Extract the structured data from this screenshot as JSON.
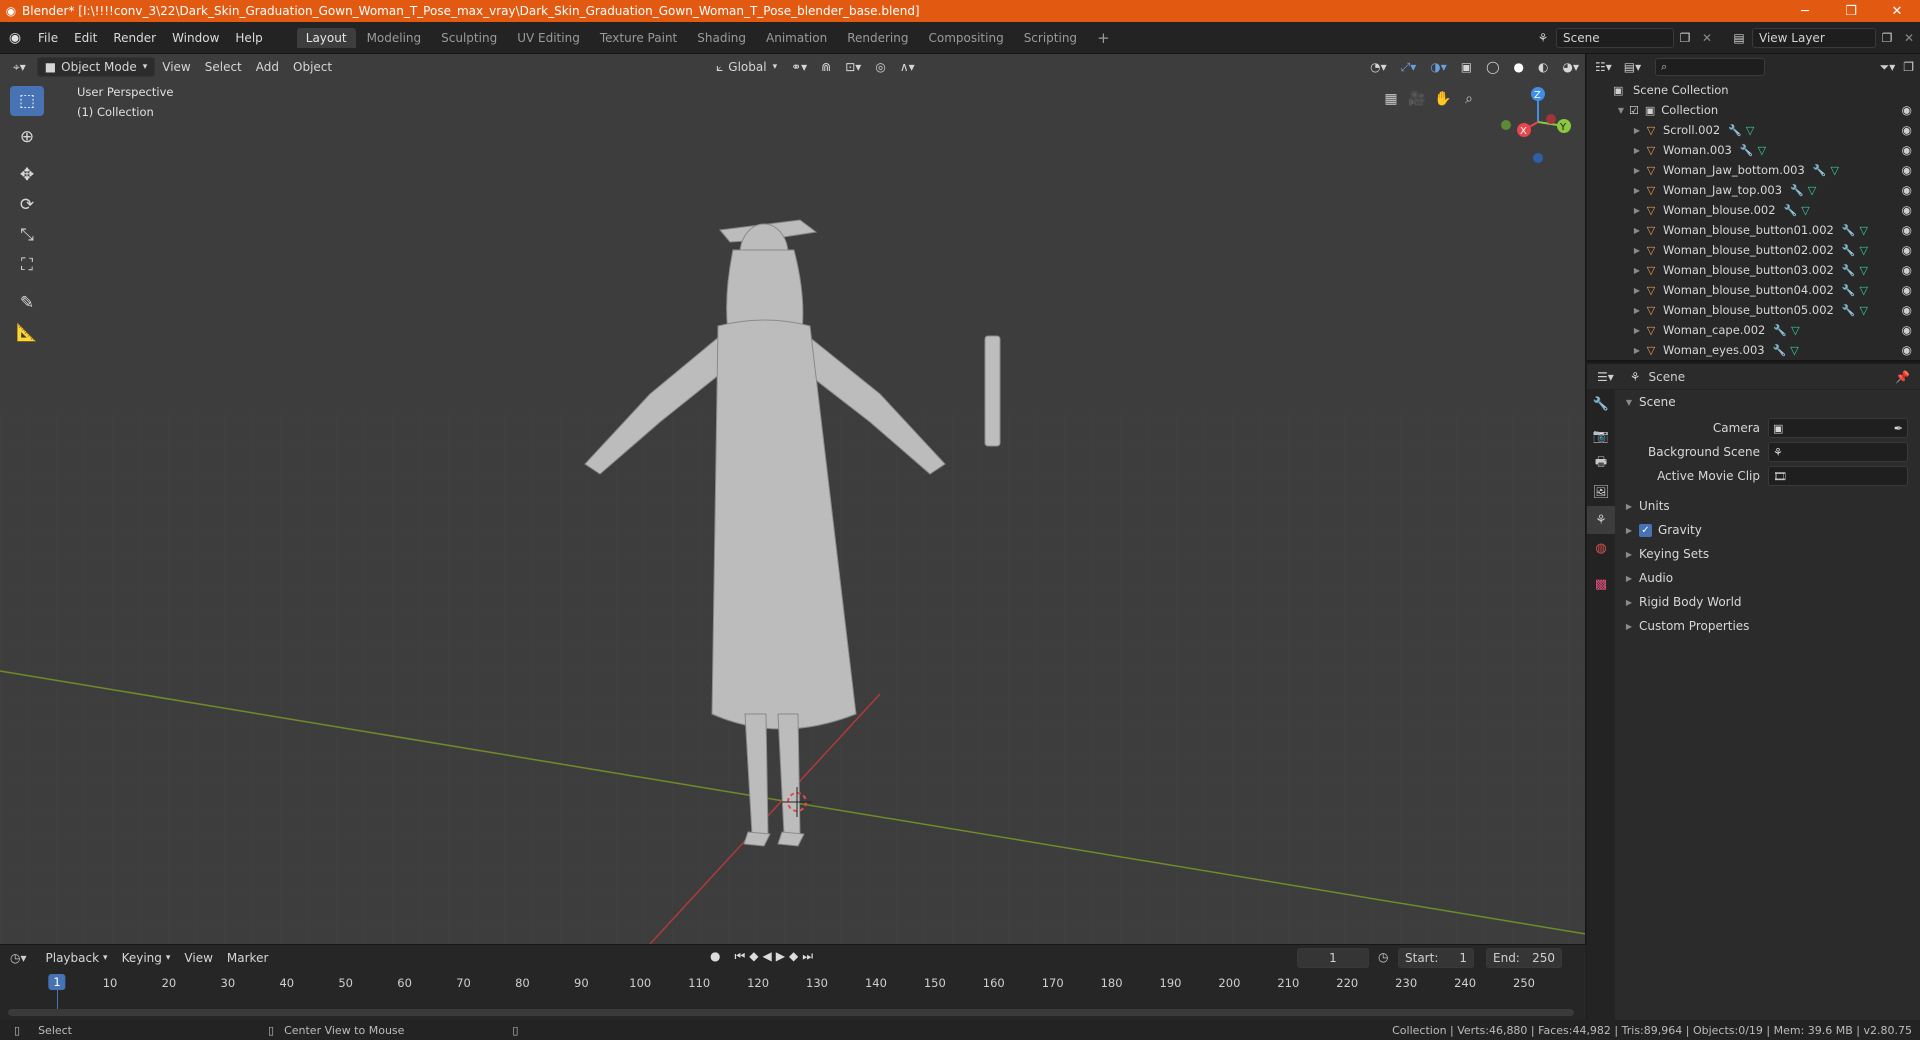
{
  "window": {
    "title": "Blender* [I:\\!!!!conv_3\\22\\Dark_Skin_Graduation_Gown_Woman_T_Pose_max_vray\\Dark_Skin_Graduation_Gown_Woman_T_Pose_blender_base.blend]",
    "minimize": "─",
    "maximize": "❐",
    "close": "✕"
  },
  "menu": [
    "File",
    "Edit",
    "Render",
    "Window",
    "Help"
  ],
  "workspaces": [
    "Layout",
    "Modeling",
    "Sculpting",
    "UV Editing",
    "Texture Paint",
    "Shading",
    "Animation",
    "Rendering",
    "Compositing",
    "Scripting"
  ],
  "workspace_add": "+",
  "scene_field": "Scene",
  "view_layer_field": "View Layer",
  "viewport": {
    "mode": "Object Mode",
    "menus": [
      "View",
      "Select",
      "Add",
      "Object"
    ],
    "orientation": "Global",
    "perspective_label": "User Perspective",
    "collection_label": "(1) Collection",
    "gizmo": {
      "z": "Z",
      "y": "Y",
      "x": "X"
    }
  },
  "outliner": {
    "root": "Scene Collection",
    "collection": "Collection",
    "items": [
      {
        "name": "Scroll.002"
      },
      {
        "name": "Woman.003"
      },
      {
        "name": "Woman_Jaw_bottom.003"
      },
      {
        "name": "Woman_Jaw_top.003"
      },
      {
        "name": "Woman_blouse.002"
      },
      {
        "name": "Woman_blouse_button01.002"
      },
      {
        "name": "Woman_blouse_button02.002"
      },
      {
        "name": "Woman_blouse_button03.002"
      },
      {
        "name": "Woman_blouse_button04.002"
      },
      {
        "name": "Woman_blouse_button05.002"
      },
      {
        "name": "Woman_cape.002"
      },
      {
        "name": "Woman_eyes.003"
      }
    ]
  },
  "properties": {
    "header": "Scene",
    "section": "Scene",
    "camera_label": "Camera",
    "background_scene_label": "Background Scene",
    "active_movie_clip_label": "Active Movie Clip",
    "panels": [
      "Units",
      "Gravity",
      "Keying Sets",
      "Audio",
      "Rigid Body World",
      "Custom Properties"
    ],
    "gravity_checked": true
  },
  "timeline": {
    "menus": [
      "Playback",
      "Keying",
      "View",
      "Marker"
    ],
    "current_frame": "1",
    "start_label": "Start:",
    "start": "1",
    "end_label": "End:",
    "end": "250",
    "ticks": [
      "1",
      "10",
      "20",
      "30",
      "40",
      "50",
      "60",
      "70",
      "80",
      "90",
      "100",
      "110",
      "120",
      "130",
      "140",
      "150",
      "160",
      "170",
      "180",
      "190",
      "200",
      "210",
      "220",
      "230",
      "240",
      "250"
    ]
  },
  "status": {
    "left_action": "Select",
    "middle_action": "Center View to Mouse",
    "right_info": "Collection | Verts:46,880 | Faces:44,982 | Tris:89,964 | Objects:0/19 | Mem: 39.6 MB | v2.80.75"
  },
  "colors": {
    "title_bar": "#e25a12",
    "accent_blue": "#4772b3",
    "object_orange": "#f0a04b",
    "mesh_green": "#35d3a4",
    "axis_x": "#e8464c",
    "axis_y": "#8bc63f",
    "axis_z": "#3f8ee8"
  }
}
